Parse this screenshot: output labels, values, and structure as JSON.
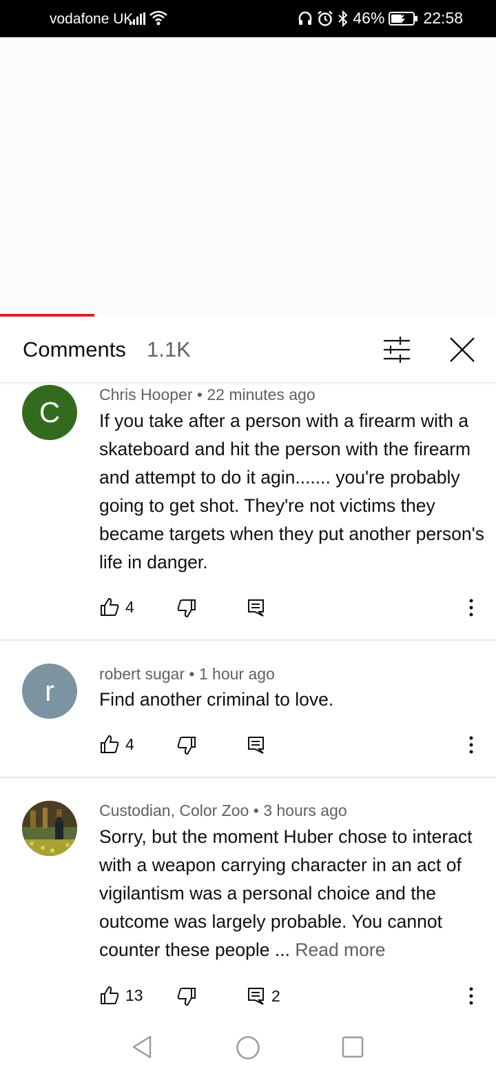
{
  "status_bar": {
    "carrier": "vodafone UK",
    "battery": "46%",
    "time": "22:58",
    "icons": [
      "signal-icon",
      "wifi-icon",
      "headphones-icon",
      "alarm-icon",
      "bluetooth-icon",
      "battery-icon"
    ]
  },
  "header": {
    "title": "Comments",
    "count": "1.1K",
    "icons": [
      "filter-icon",
      "close-icon"
    ]
  },
  "comments": [
    {
      "avatar_letter": "C",
      "avatar_color": "#336b1e",
      "author": "Chris Hooper",
      "time": "22 minutes ago",
      "text": "If you take after a person with a firearm with a skateboard and hit the person with the firearm and attempt to do it agin....... you're probably going to get shot. They're not victims they became targets when they put another person's life in danger.",
      "likes": "4",
      "replies": ""
    },
    {
      "avatar_letter": "r",
      "avatar_color": "#7c93a1",
      "author": "robert sugar",
      "time": "1 hour ago",
      "text": "Find another criminal to love.",
      "likes": "4",
      "replies": ""
    },
    {
      "avatar_letter": "",
      "avatar_color": "#3d3a22",
      "author": "Custodian, Color Zoo",
      "time": "3 hours ago",
      "text": "Sorry, but the moment Huber chose to interact with a weapon carrying character in an act of vigilantism was a personal choice and the outcome was largely probable. You cannot counter these people ... ",
      "read_more": "Read more",
      "likes": "13",
      "replies": "2"
    }
  ],
  "nav_bar": {
    "icons": [
      "back-icon",
      "home-icon",
      "recents-icon"
    ]
  }
}
